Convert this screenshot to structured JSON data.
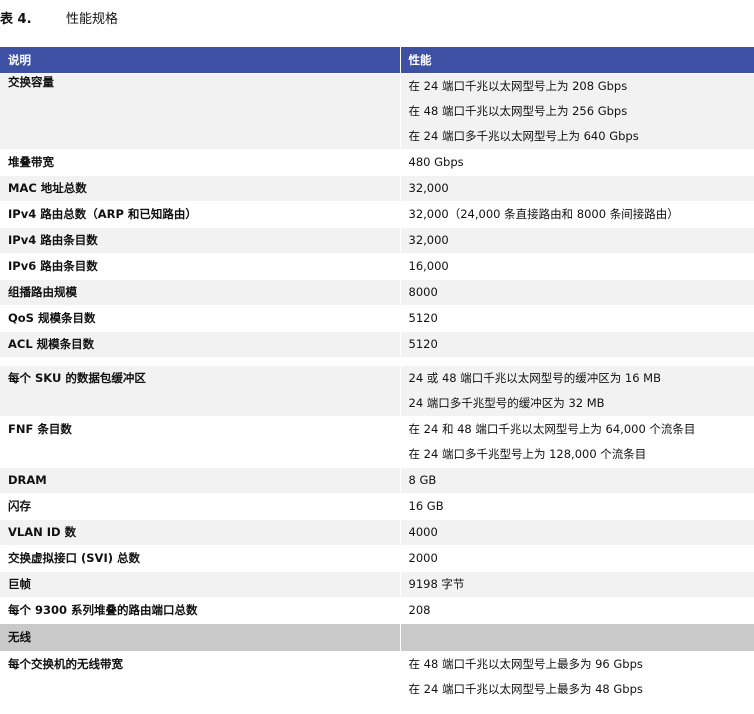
{
  "caption": {
    "number": "表 4.",
    "title": "性能规格"
  },
  "table": {
    "headers": [
      "说明",
      "性能"
    ],
    "rows": [
      {
        "label": "交换容量",
        "values": [
          "在 24 端口千兆以太网型号上为 208 Gbps",
          "在 48 端口千兆以太网型号上为 256 Gbps",
          "在 24 端口多千兆以太网型号上为 640 Gbps"
        ]
      },
      {
        "label": "堆叠带宽",
        "values": [
          "480 Gbps"
        ]
      },
      {
        "label": "MAC 地址总数",
        "values": [
          "32,000"
        ]
      },
      {
        "label": "IPv4 路由总数（ARP 和已知路由）",
        "values": [
          "32,000（24,000 条直接路由和 8000 条间接路由）"
        ]
      },
      {
        "label": "IPv4 路由条目数",
        "values": [
          "32,000"
        ]
      },
      {
        "label": "IPv6 路由条目数",
        "values": [
          "16,000"
        ]
      },
      {
        "label": "组播路由规模",
        "values": [
          "8000"
        ]
      },
      {
        "label": "QoS 规模条目数",
        "values": [
          "5120"
        ]
      },
      {
        "label": "ACL 规模条目数",
        "values": [
          "5120"
        ]
      },
      {
        "label": "每个 SKU 的数据包缓冲区",
        "values": [
          "24 或 48 端口千兆以太网型号的缓冲区为 16 MB",
          "24 端口多千兆型号的缓冲区为 32 MB"
        ]
      },
      {
        "label": "FNF 条目数",
        "values": [
          "在 24 和 48 端口千兆以太网型号上为 64,000 个流条目",
          "在 24 端口多千兆型号上为 128,000 个流条目"
        ]
      },
      {
        "label": "DRAM",
        "values": [
          "8 GB"
        ]
      },
      {
        "label": "闪存",
        "values": [
          "16 GB"
        ]
      },
      {
        "label": "VLAN ID 数",
        "values": [
          "4000"
        ]
      },
      {
        "label": "交换虚拟接口 (SVI) 总数",
        "values": [
          "2000"
        ]
      },
      {
        "label": "巨帧",
        "values": [
          "9198 字节"
        ]
      },
      {
        "label": "每个 9300 系列堆叠的路由端口总数",
        "values": [
          "208"
        ]
      }
    ],
    "section_wireless": "无线",
    "wireless_rows": [
      {
        "label": "每个交换机的无线带宽",
        "values": [
          "在 48 端口千兆以太网型号上最多为 96 Gbps",
          "在 24 端口千兆以太网型号上最多为 48 Gbps"
        ]
      }
    ]
  }
}
